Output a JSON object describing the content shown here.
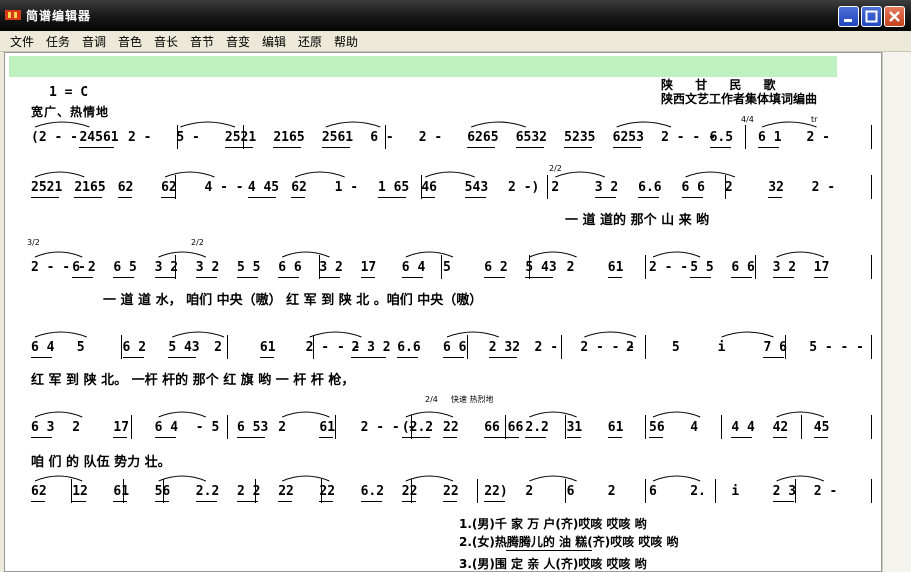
{
  "window": {
    "title": "简谱编辑器"
  },
  "menu": [
    "文件",
    "任务",
    "音调",
    "音色",
    "音长",
    "音节",
    "音变",
    "编辑",
    "还原",
    "帮助"
  ],
  "score": {
    "key": "1 = C",
    "tempo_mark": "宽广、热情地",
    "source": "陕   甘   民   歌",
    "credit": "陕西文艺工作者集体填词编曲",
    "rows": [
      [
        "(2 - -",
        "24561",
        "2 -",
        "5 -",
        "2521",
        "2165",
        "2561",
        "6 -",
        "2 -",
        "6265",
        "6532",
        "5235",
        "6253",
        "2 - - -",
        "6.5",
        "6 1",
        "2 -"
      ],
      [
        "2521",
        "2165",
        "62",
        "62",
        "4 - -",
        "4 45",
        "62",
        "1 -",
        "1 65",
        "46",
        "543",
        "2 -)",
        "2",
        "3 2",
        "6.6",
        "6 6",
        "2",
        "32",
        "2 -"
      ],
      [
        "2 - - -",
        "6 2",
        "6 5",
        "3 2",
        "3 2",
        "5 5",
        "6 6",
        "3 2",
        "17",
        "6 4",
        "5",
        "6 2",
        "5 43",
        "2",
        "61",
        "2 - -",
        "5 5",
        "6 6",
        "3 2",
        "17"
      ],
      [
        "6 4",
        "5",
        "6 2",
        "5 43",
        "2",
        "61",
        "2 - - -",
        "2 3 2",
        "6.6",
        "6 6",
        "2 32",
        "2 -",
        "2 - - -",
        "2",
        "5",
        "i",
        "7 6",
        "5 - - -"
      ],
      [
        "6 3",
        "2",
        "17",
        "6 4",
        "- 5",
        "6 53",
        "2",
        "61",
        "2 - - -",
        "(2.2",
        "22",
        "66 66",
        "2.2",
        "31",
        "61",
        "56",
        "4",
        "4 4",
        "42",
        "45"
      ],
      [
        "62",
        "12",
        "61",
        "56",
        "2.2",
        "2 2",
        "22",
        "22",
        "6.2",
        "22",
        "22",
        "22)",
        "2",
        "6",
        "2",
        "6",
        "2.",
        "i",
        "2 3",
        "2 -"
      ]
    ],
    "time_marks": [
      "4/4",
      "2/2",
      "3/2",
      "2/2",
      "2/4"
    ],
    "tempo_change": "快速  热烈地",
    "trill": "tr",
    "lyrics": [
      "一   道     道的   那个  山   来  哟",
      "一  道      道  水，  咱们  中央（嗷）   红    军     到      陕   北  。咱们  中央（嗷）",
      "红    军    到     陕   北。    一杆 杆的 那个  红 旗 哟             一    杆 杆     枪，",
      "咱  们   的   队伍      势力       壮。"
    ],
    "verses": [
      "1.(男)千   家       万     户(齐)哎咳  哎咳     哟",
      "2.(女)热腾腾儿的     油     糕(齐)哎咳  哎咳     哟",
      "3.(男)围   定       亲     人(齐)哎咳  哎咳     哟"
    ]
  }
}
